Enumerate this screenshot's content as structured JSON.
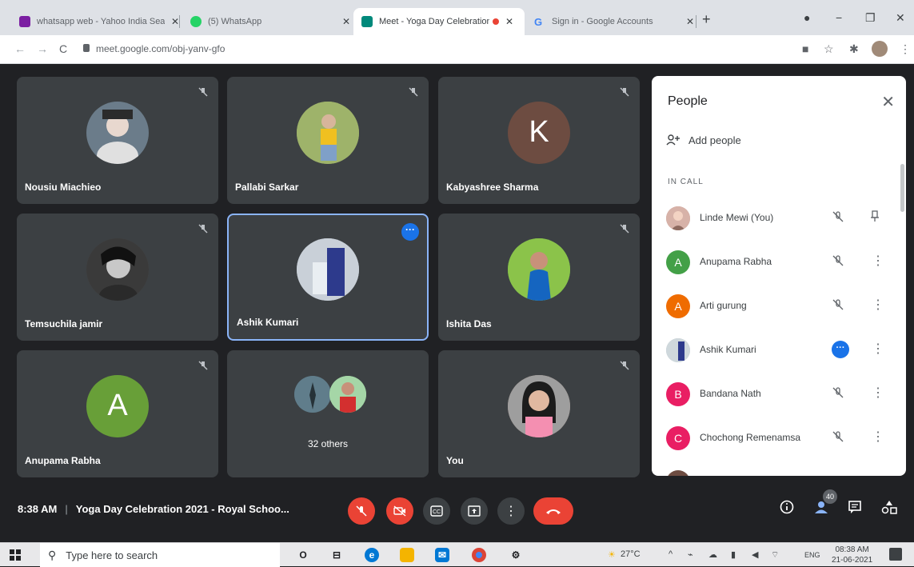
{
  "browser": {
    "tabs": [
      {
        "title": "whatsapp web - Yahoo India Sea",
        "favicon_color": "#7b1fa2"
      },
      {
        "title": "(5) WhatsApp",
        "favicon_color": "#25d366"
      },
      {
        "title": "Meet - Yoga Day Celebration",
        "favicon_color": "#00897b",
        "active": true
      },
      {
        "title": "Sign in - Google Accounts",
        "favicon_color": "#4285f4"
      }
    ],
    "url": "meet.google.com/obj-yanv-gfo"
  },
  "tiles": [
    {
      "name": "Nousiu Miachieo",
      "avatar_color": "#6b7c8a",
      "initial": ""
    },
    {
      "name": "Pallabi Sarkar",
      "avatar_color": "#8a9a5b",
      "initial": ""
    },
    {
      "name": "Kabyashree Sharma",
      "avatar_color": "#6d4c41",
      "initial": "K"
    },
    {
      "name": "Temsuchila jamir",
      "avatar_color": "#505050",
      "initial": ""
    },
    {
      "name": "Ashik Kumari",
      "avatar_color": "#9eaab8",
      "initial": ""
    },
    {
      "name": "Ishita Das",
      "avatar_color": "#4caf50",
      "initial": ""
    },
    {
      "name": "Anupama Rabha",
      "avatar_color": "#689f38",
      "initial": "A"
    },
    {
      "name": "",
      "others_label": "32 others"
    },
    {
      "name": "You",
      "avatar_color": "#b08a7a",
      "initial": ""
    }
  ],
  "people_panel": {
    "title": "People",
    "add_label": "Add people",
    "section": "IN CALL",
    "people": [
      {
        "name": "Linde Mewi (You)",
        "avatar_color": "#c9a39a",
        "initial": ""
      },
      {
        "name": "Anupama Rabha",
        "avatar_color": "#43a047",
        "initial": "A"
      },
      {
        "name": "Arti gurung",
        "avatar_color": "#ef6c00",
        "initial": "A"
      },
      {
        "name": "Ashik Kumari",
        "avatar_color": "#b0bec5",
        "initial": ""
      },
      {
        "name": "Bandana Nath",
        "avatar_color": "#e91e63",
        "initial": "B"
      },
      {
        "name": "Chochong Remenamsa",
        "avatar_color": "#e91e63",
        "initial": "C"
      }
    ]
  },
  "meeting": {
    "time": "8:38 AM",
    "title": "Yoga Day Celebration 2021 - Royal Schoo...",
    "participant_count": "40"
  },
  "taskbar": {
    "search_placeholder": "Type here to search",
    "weather": "27°C",
    "lang": "ENG",
    "time": "08:38 AM",
    "date": "21-06-2021"
  }
}
